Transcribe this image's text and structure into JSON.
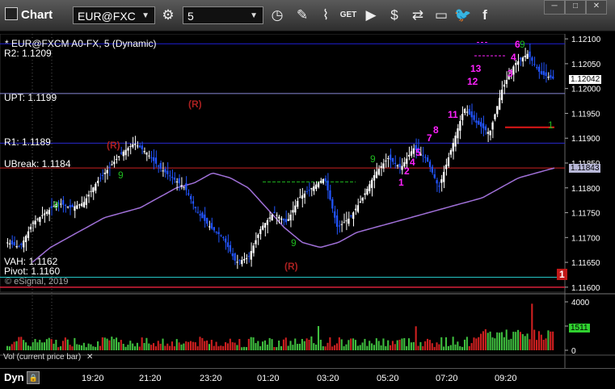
{
  "toolbar": {
    "title": "Chart",
    "symbol": "EUR@FXC",
    "interval": "5",
    "window_controls": [
      "─",
      "□",
      "✕"
    ],
    "icons": [
      "gear-icon",
      "clock-icon",
      "pencil-icon",
      "line-chart-icon",
      "get-quote-icon",
      "play-icon",
      "dollar-icon",
      "swap-icon",
      "comment-icon",
      "twitter-icon",
      "facebook-icon"
    ]
  },
  "chart_header": "* EUR@FXCM A0-FX, 5 (Dynamic)",
  "levels": [
    {
      "label": "R2: 1.1209",
      "price": 1.1209,
      "color": "#1f1fd6"
    },
    {
      "label": "UPT: 1.1199",
      "price": 1.1199,
      "color": "#8a8ad8"
    },
    {
      "label": "R1: 1.1189",
      "price": 1.1189,
      "color": "#2a2ad0"
    },
    {
      "label": "UBreak: 1.1184",
      "price": 1.1184,
      "color": "#cc2222"
    },
    {
      "label": "VAH: 1.1162",
      "price": 1.1162,
      "color": "#25c7c7"
    },
    {
      "label": "Pivot: 1.1160",
      "price": 1.116,
      "color": "#d8203a"
    }
  ],
  "watermark": "© eSignal, 2019",
  "price_tags": {
    "last": "1.12042",
    "ma": "1.11843",
    "volume": "1511"
  },
  "volume_label": "Vol (current price bar)",
  "bottom": {
    "mode": "Dyn",
    "mode_icon": "lock-icon"
  },
  "colors": {
    "up": "#ffffff",
    "down": "#2255ff",
    "ma": "#a070d8",
    "td_setup": "#1fb81f",
    "td_count": "#ff22ff",
    "r_marker": "#aa2020"
  },
  "chart_data": {
    "type": "candlestick",
    "ylim": [
      1.1159,
      1.1211
    ],
    "yticks": [
      1.121,
      1.1205,
      1.12,
      1.1195,
      1.119,
      1.1185,
      1.118,
      1.1175,
      1.117,
      1.1165,
      1.116
    ],
    "ytick_labels": [
      "1.12100",
      "1.12050",
      "1.12000",
      "1.11950",
      "1.11900",
      "1.11850",
      "1.11800",
      "1.11750",
      "1.11700",
      "1.11650",
      "1.11600"
    ],
    "xticks": [
      "19:20",
      "21:20",
      "23:20",
      "01:20",
      "03:20",
      "05:20",
      "07:20",
      "09:20"
    ],
    "volume_ylim": [
      0,
      4000
    ],
    "volume_ticks": [
      4000,
      2000,
      0
    ],
    "volume_tick_labels": [
      "4000",
      "2000",
      "0"
    ],
    "close_path": [
      1.1169,
      1.1168,
      1.1173,
      1.1175,
      1.1177,
      1.1176,
      1.1177,
      1.1181,
      1.1184,
      1.1187,
      1.1189,
      1.1187,
      1.1184,
      1.1182,
      1.118,
      1.1175,
      1.1172,
      1.117,
      1.1165,
      1.1166,
      1.1172,
      1.1175,
      1.1173,
      1.1178,
      1.118,
      1.1182,
      1.1172,
      1.1174,
      1.1178,
      1.1183,
      1.1186,
      1.1184,
      1.1188,
      1.1186,
      1.118,
      1.1188,
      1.1196,
      1.1193,
      1.1191,
      1.12,
      1.1205,
      1.1207,
      1.1203,
      1.1202
    ],
    "ma_path": [
      1.1165,
      1.1168,
      1.117,
      1.1172,
      1.1174,
      1.1175,
      1.1176,
      1.1178,
      1.118,
      1.1181,
      1.1183,
      1.1182,
      1.118,
      1.1176,
      1.1172,
      1.1169,
      1.1168,
      1.1169,
      1.1171,
      1.1172,
      1.1173,
      1.1174,
      1.1175,
      1.1176,
      1.1177,
      1.1178,
      1.118,
      1.1182,
      1.1183,
      1.1184
    ],
    "td_count_labels": [
      "1",
      "2",
      "4",
      "5",
      "7",
      "8",
      "11",
      "12",
      "13",
      "3",
      "4",
      "6"
    ],
    "td_setup_labels": [
      "9",
      "9",
      "9",
      "9",
      "9",
      "1"
    ],
    "r_markers": [
      "(R)",
      "(R)",
      "(R)"
    ],
    "last_bar_count": "1"
  }
}
